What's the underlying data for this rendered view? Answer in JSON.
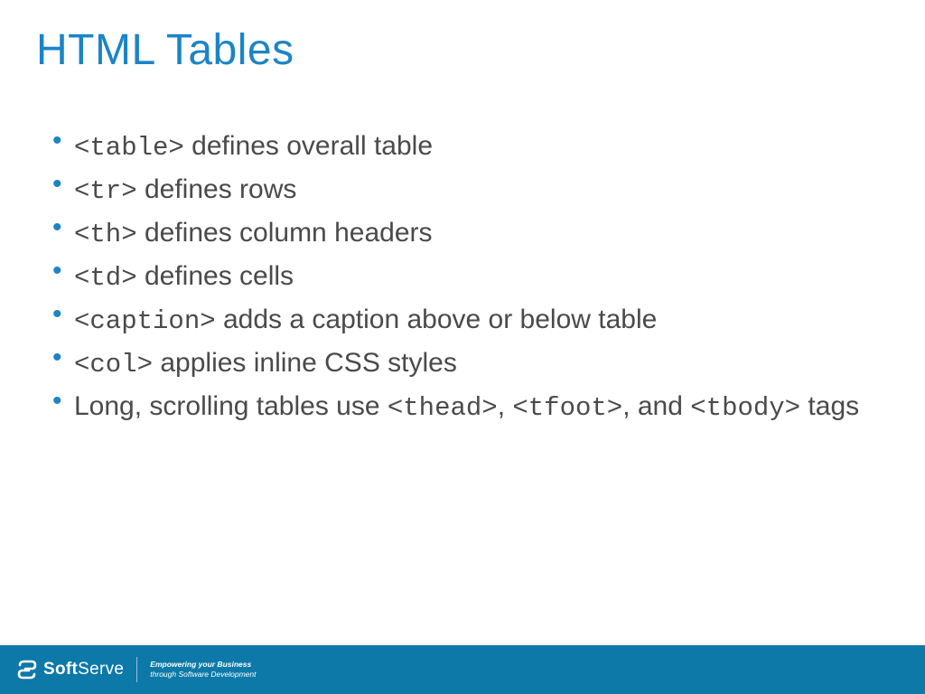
{
  "title": "HTML Tables",
  "bullets": [
    {
      "code": "<table>",
      "text": " defines overall table"
    },
    {
      "code": "<tr>",
      "text": " defines rows"
    },
    {
      "code": "<th>",
      "text": " defines column headers"
    },
    {
      "code": "<td>",
      "text": " defines cells"
    },
    {
      "code": "<caption>",
      "text": " adds a caption above or below table"
    },
    {
      "code": "<col>",
      "text": " applies inline CSS styles"
    }
  ],
  "bullet7": {
    "pre": "Long, scrolling tables use ",
    "code1": "<thead>",
    "mid1": ", ",
    "code2": "<tfoot>",
    "mid2": ", and ",
    "code3": "<tbody>",
    "post": " tags"
  },
  "footer": {
    "brand_bold": "Soft",
    "brand_light": "Serve",
    "tagline1": "Empowering your Business",
    "tagline2": "through Software Development"
  }
}
